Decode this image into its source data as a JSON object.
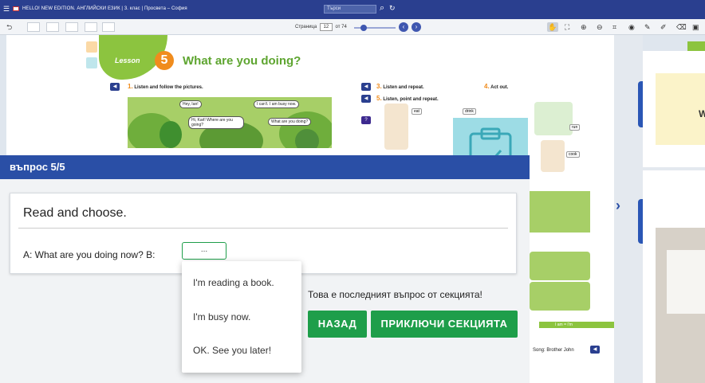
{
  "app": {
    "title_bar": "HELLO! NEW EDITION. АНГЛИЙСКИ ЕЗИК | 3. клас | Просвета – София",
    "search_placeholder": "Търси"
  },
  "toolbar": {
    "page_label": "Страница",
    "page_number": "12",
    "page_total": "от 74"
  },
  "book": {
    "lesson_word": "Lesson",
    "lesson_number": "5",
    "lesson_title": "What are you doing?",
    "ex1_num": "1.",
    "ex1_text": "Listen and follow the pictures.",
    "ex3_num": "3.",
    "ex3_text": "Listen and repeat.",
    "ex4_num": "4.",
    "ex4_text": "Act out.",
    "ex5_num": "5.",
    "ex5_text": "Listen, point and repeat.",
    "bubbles": [
      "Hey, Ian!",
      "I can't. I am busy now.",
      "Hi, Karl! Where are you going?",
      "What are you doing?"
    ],
    "tags": [
      "eat",
      "drink",
      "run",
      "cook"
    ],
    "strip_text": "I am = I'm",
    "song": "Song: Brother John",
    "right_word": "W"
  },
  "quiz": {
    "header": "въпрос 5/5",
    "instruction": "Read and choose.",
    "question": "A: What are you doing now? B:",
    "dropdown_value": "...",
    "options": [
      "I'm reading a book.",
      "I'm busy now.",
      "OK. See you later!"
    ],
    "last_question_note": "Това е последният въпрос от секцията!",
    "back_button": "НАЗАД",
    "finish_button": "ПРИКЛЮЧИ СЕКЦИЯТА"
  },
  "colors": {
    "header_blue": "#2a3f8f",
    "quiz_blue": "#2a4fa6",
    "button_green": "#1e9e4a",
    "lesson_orange": "#f08c1d",
    "lesson_green": "#5ea530"
  }
}
